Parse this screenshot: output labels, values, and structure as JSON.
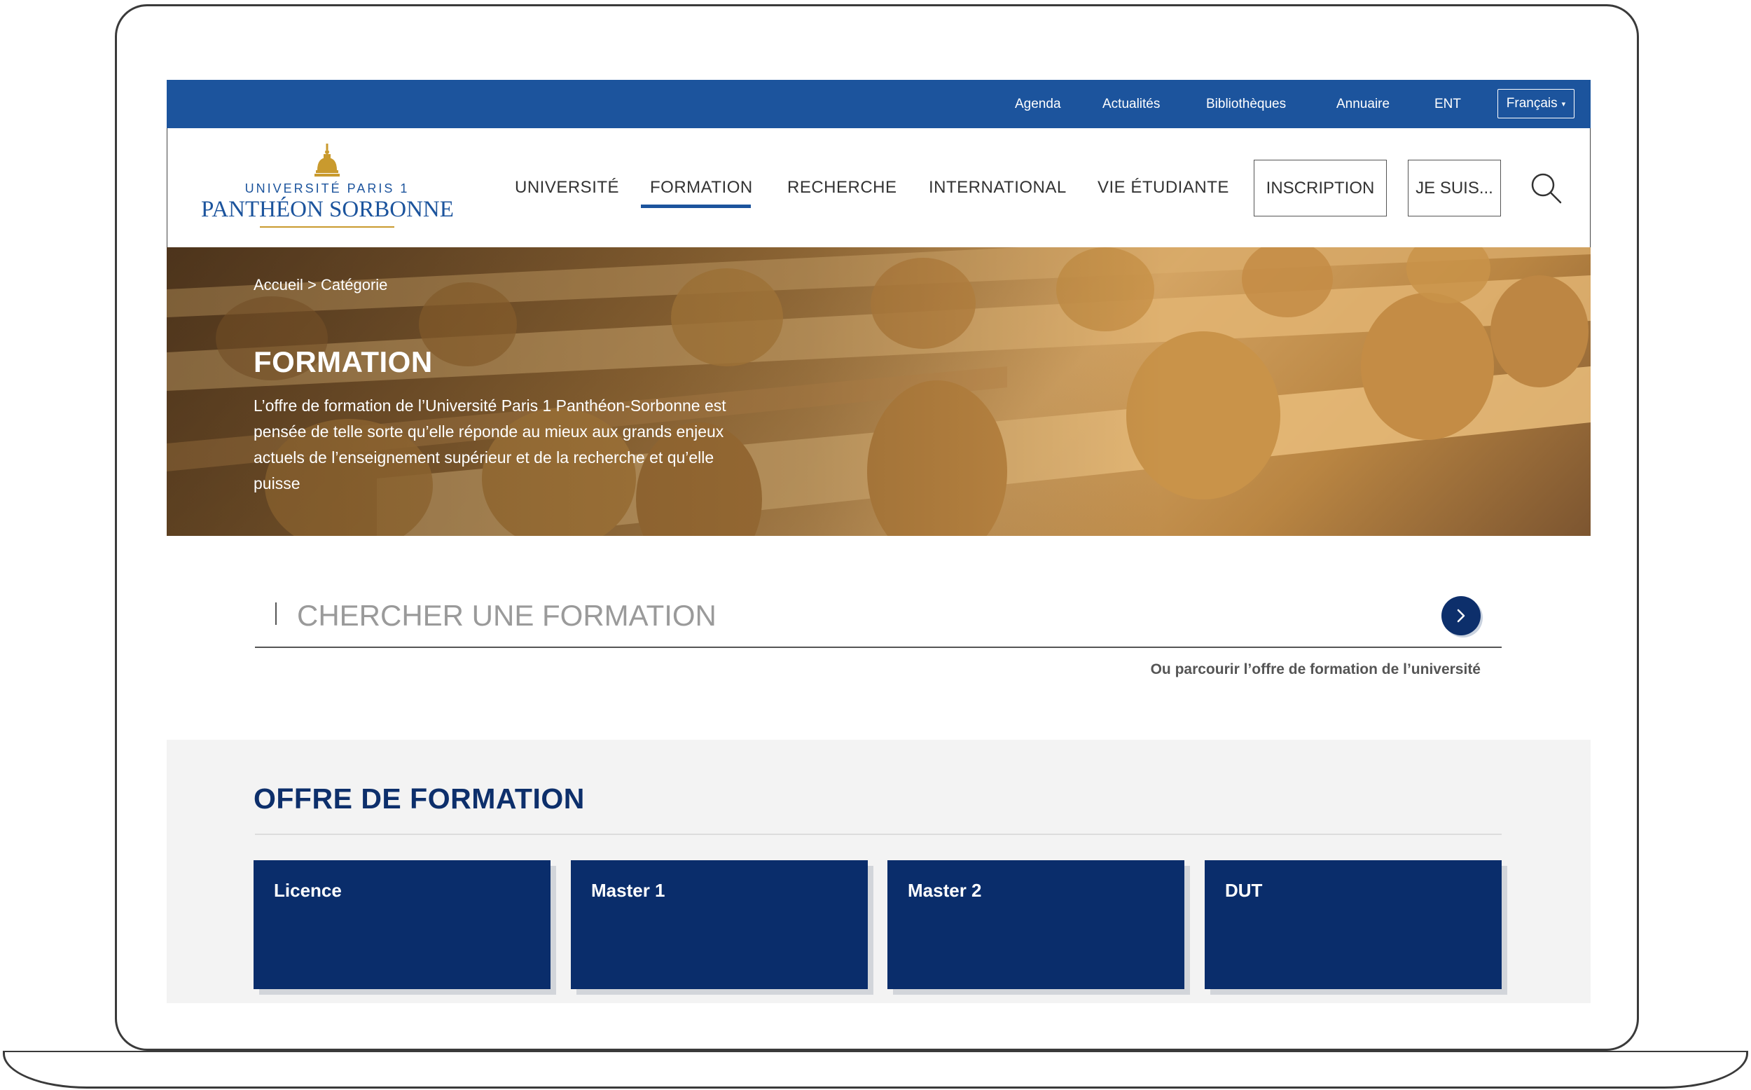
{
  "topbar": {
    "links": [
      "Agenda",
      "Actualités",
      "Bibliothèques",
      "Annuaire",
      "ENT"
    ],
    "language": "Français"
  },
  "logo": {
    "line1": "UNIVERSITÉ PARIS 1",
    "line2": "PANTHÉON SORBONNE"
  },
  "nav": {
    "items": [
      "UNIVERSITÉ",
      "FORMATION",
      "RECHERCHE",
      "INTERNATIONAL",
      "VIE ÉTUDIANTE"
    ],
    "active": "FORMATION",
    "inscription": "INSCRIPTION",
    "je_suis": "JE SUIS..."
  },
  "hero": {
    "breadcrumb_home": "Accueil",
    "breadcrumb_sep": " > ",
    "breadcrumb_current": "Catégorie",
    "title": "FORMATION",
    "description": "L’offre de formation de l’Université Paris 1 Panthéon-Sorbonne est pensée de telle sorte qu’elle réponde au mieux aux grands enjeux actuels de l’enseignement supérieur et de la recherche et qu’elle puisse"
  },
  "search": {
    "placeholder": "CHERCHER UNE FORMATION",
    "browse_link": "Ou parcourir l’offre de formation de l’université"
  },
  "offer": {
    "title": "OFFRE DE FORMATION",
    "cards": [
      "Licence",
      "Master 1",
      "Master 2",
      "DUT"
    ]
  },
  "colors": {
    "topbar": "#1c549d",
    "brand_dark": "#0a2d6b",
    "gold": "#c99a2e"
  },
  "icons": {
    "search": "search-icon",
    "caret": "caret-down-icon",
    "arrow": "chevron-right-icon"
  }
}
